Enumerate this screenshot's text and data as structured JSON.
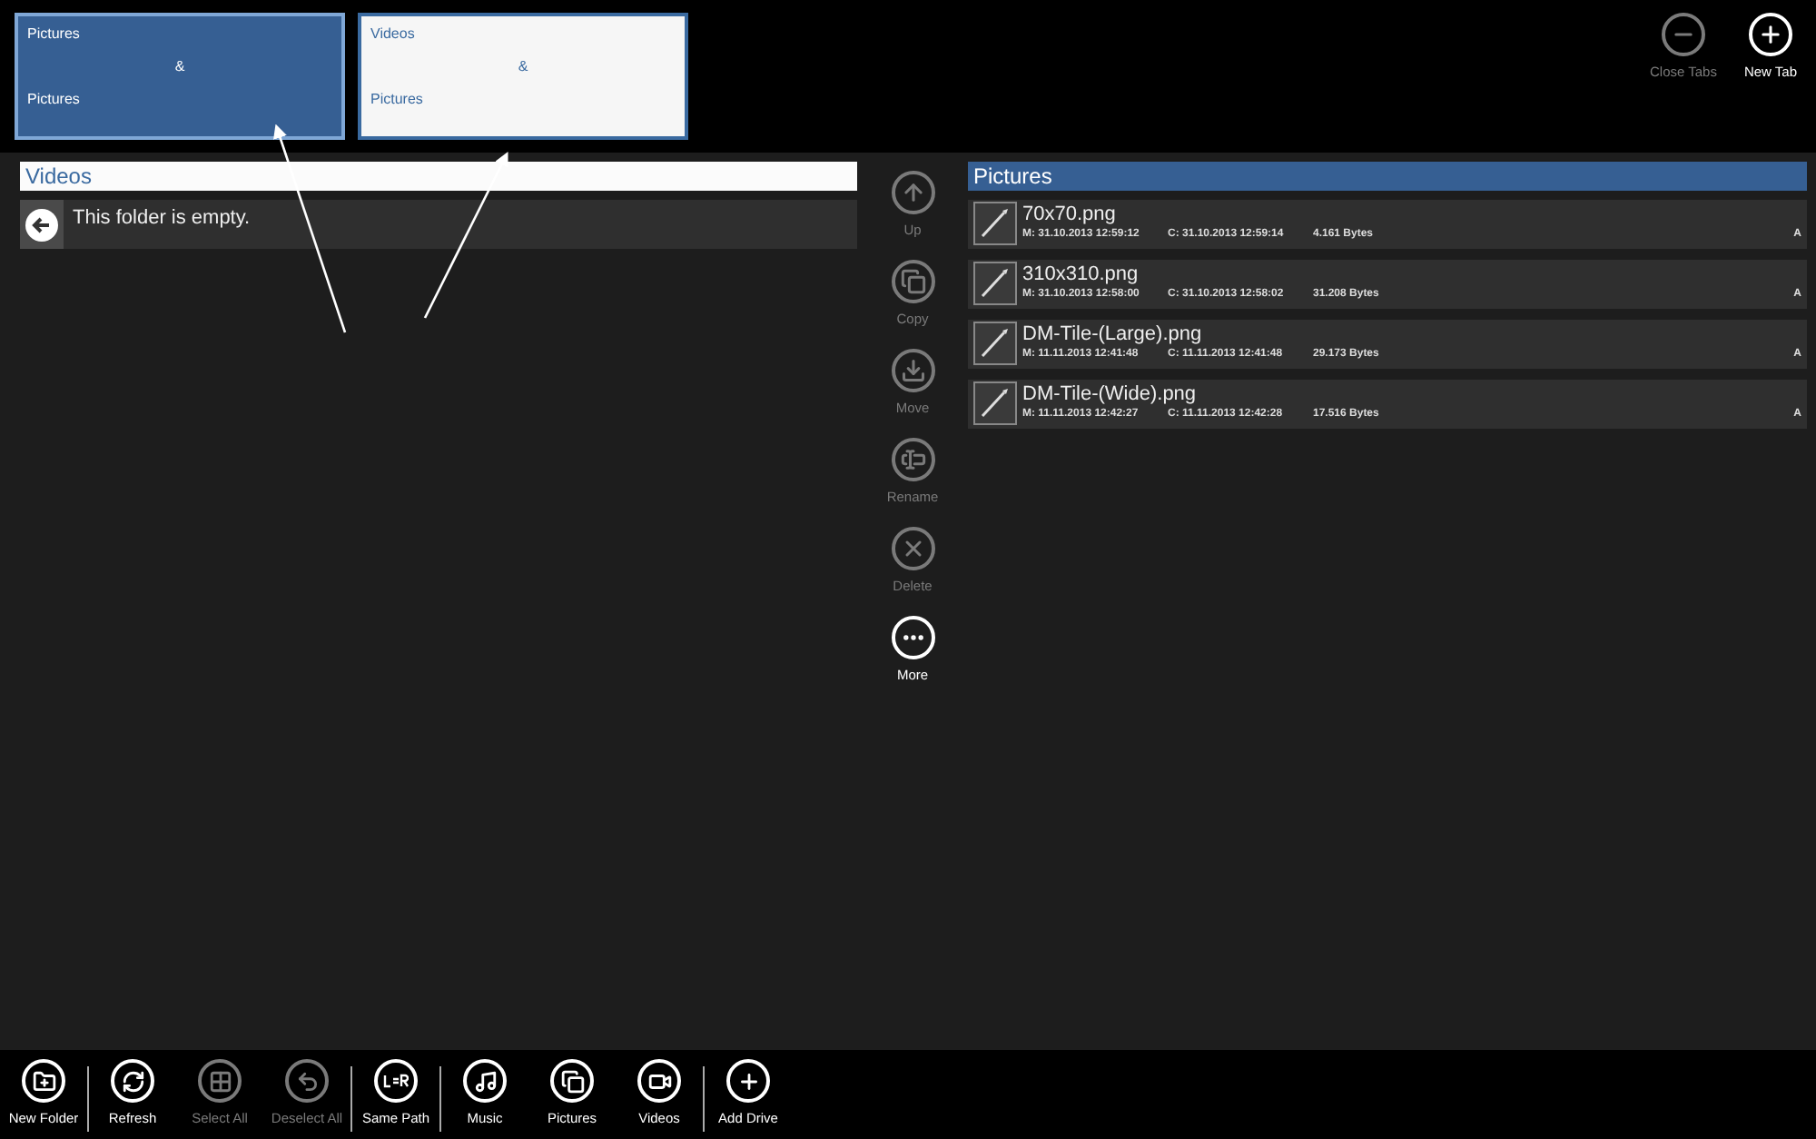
{
  "tabs": [
    {
      "top": "Pictures",
      "middle": "&",
      "bottom": "Pictures",
      "selected": true
    },
    {
      "top": "Videos",
      "middle": "&",
      "bottom": "Pictures",
      "selected": false
    }
  ],
  "tab_actions": [
    {
      "label": "Close Tabs",
      "disabled": true
    },
    {
      "label": "New Tab",
      "disabled": false
    }
  ],
  "left_pane": {
    "title": "Videos",
    "selected": false,
    "message": "This folder is empty."
  },
  "commands": [
    {
      "label": "Up",
      "disabled": true
    },
    {
      "label": "Copy",
      "disabled": true
    },
    {
      "label": "Move",
      "disabled": true
    },
    {
      "label": "Rename",
      "disabled": true
    },
    {
      "label": "Delete",
      "disabled": true
    },
    {
      "label": "More",
      "disabled": false
    }
  ],
  "right_pane": {
    "title": "Pictures",
    "selected": true,
    "files": [
      {
        "name": "70x70.png",
        "modified": "M: 31.10.2013 12:59:12",
        "created": "C: 31.10.2013 12:59:14",
        "size": "4.161 Bytes",
        "attributes": "A"
      },
      {
        "name": "310x310.png",
        "modified": "M: 31.10.2013 12:58:00",
        "created": "C: 31.10.2013 12:58:02",
        "size": "31.208 Bytes",
        "attributes": "A"
      },
      {
        "name": "DM-Tile-(Large).png",
        "modified": "M: 11.11.2013 12:41:48",
        "created": "C: 11.11.2013 12:41:48",
        "size": "29.173 Bytes",
        "attributes": "A"
      },
      {
        "name": "DM-Tile-(Wide).png",
        "modified": "M: 11.11.2013 12:42:27",
        "created": "C: 11.11.2013 12:42:28",
        "size": "17.516 Bytes",
        "attributes": "A"
      }
    ]
  },
  "app_bar": [
    [
      {
        "label": "New Folder",
        "disabled": false
      }
    ],
    [
      {
        "label": "Refresh",
        "disabled": false
      },
      {
        "label": "Select All",
        "disabled": true
      },
      {
        "label": "Deselect All",
        "disabled": true
      }
    ],
    [
      {
        "label": "Same Path",
        "disabled": false
      }
    ],
    [
      {
        "label": "Music",
        "disabled": false
      },
      {
        "label": "Pictures",
        "disabled": false
      },
      {
        "label": "Videos",
        "disabled": false
      }
    ],
    [
      {
        "label": "Add Drive",
        "disabled": false
      }
    ]
  ]
}
